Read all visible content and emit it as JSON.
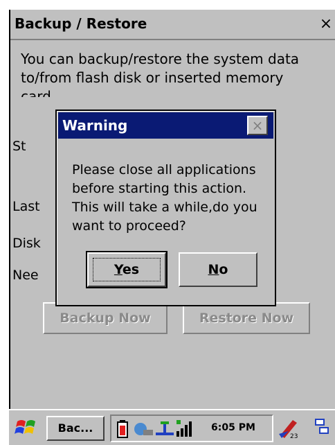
{
  "window": {
    "title": "Backup / Restore",
    "close_glyph": "×",
    "description": "You can backup/restore the system data to/from flash disk or inserted memory card",
    "labels": [
      "St",
      "Last",
      "Disk",
      "Nee"
    ],
    "backup_button": "Backup Now",
    "restore_button": "Restore Now"
  },
  "dialog": {
    "title": "Warning",
    "close_glyph": "×",
    "message": "Please close all applications before starting this action. This will take a while,do you want to proceed?",
    "yes_button": "Yes",
    "no_button": "No"
  },
  "taskbar": {
    "task_button": "Bac...",
    "clock": "6:05 PM",
    "icons": [
      "start-icon",
      "battery-icon",
      "network-icon",
      "usb-icon",
      "signal-icon",
      "input-panel-icon",
      "desktop-icon"
    ]
  },
  "colors": {
    "window_bg": "#c0c0c0",
    "dialog_title_bg": "#0a1a74"
  }
}
